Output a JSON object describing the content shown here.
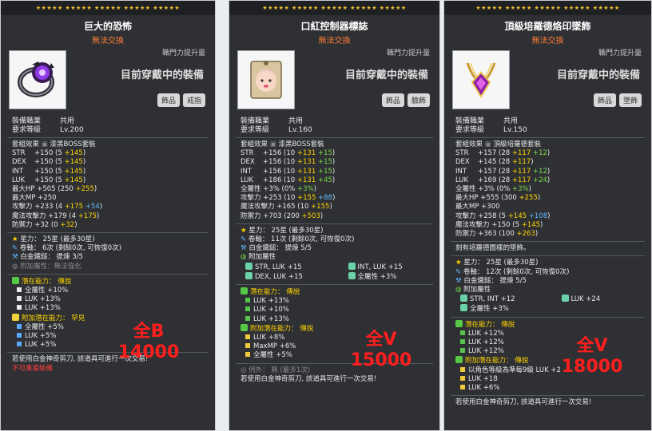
{
  "panels": [
    {
      "stars": "★★★★★   ★★★★★   ★★★★★   ★★★★★   ★★★★★",
      "title": "巨大的恐怖",
      "tradable": "無法交換",
      "equip_label": "職門力提升量",
      "equip_status": "目前穿戴中的裝備",
      "tags": [
        "飾品",
        "戒指"
      ],
      "job_label": "裝備職業",
      "job_value": "共用",
      "level_label": "要求等級",
      "level_value": "Lv.200",
      "set_label": "套組效果",
      "set_value": "漆黑BOSS套裝",
      "price_line1": "全B",
      "price_line2": "14000"
    },
    {
      "stars": "★★★★★   ★★★★★   ★★★★★   ★★★★★   ★★★★★",
      "title": "口紅控制器標誌",
      "tradable": "無法交換",
      "equip_label": "職門力提升量",
      "equip_status": "目前穿戴中的裝備",
      "tags": [
        "飾品",
        "臉飾"
      ],
      "job_label": "裝備職業",
      "job_value": "共用",
      "level_label": "要求等級",
      "level_value": "Lv.160",
      "set_label": "套組效果",
      "set_value": "漆黑BOSS套裝",
      "price_line1": "全V",
      "price_line2": "15000"
    },
    {
      "stars": "★★★★★   ★★★★★   ★★★★★   ★★★★★   ★★★★★",
      "title": "頂級培羅德烙印墜飾",
      "tradable": "無法交換",
      "equip_label": "職門力提升量",
      "equip_status": "目前穿戴中的裝備",
      "tags": [
        "飾品",
        "墜飾"
      ],
      "job_label": "裝備職業",
      "job_value": "共用",
      "level_label": "要求等級",
      "level_value": "Lv.150",
      "set_label": "套組效果",
      "set_value": "頂級培羅德套裝",
      "price_line1": "全V",
      "price_line2": "18000"
    }
  ],
  "p0": {
    "stats": [
      [
        "STR",
        "+150 (5 ",
        "+145",
        ")"
      ],
      [
        "DEX",
        "+150 (5 ",
        "+145",
        ")"
      ],
      [
        "INT",
        "+150 (5 ",
        "+145",
        ")"
      ],
      [
        "LUK",
        "+150 (5 ",
        "+145",
        ")"
      ]
    ],
    "hp": "最大HP  +505 (250 ",
    "hp_b": "+255",
    "mp": "最大MP  +250",
    "atk": "攻擊力  +233 (4 ",
    "atk_b": "+175",
    "atk_c": "+54",
    "matk": "魔法攻擊力  +179 (4 ",
    "matk_b": "+175",
    "def": "防禦力  +32 (0 ",
    "def_b": "+32",
    "star": "星力：  25星  (最多30星)",
    "scroll": "卷軸：  6次  (剩餘0次, 可恢復0次)",
    "hammer": "白金鐵鎚：  提煉  3/5",
    "addprop": "附加屬性：無法強化",
    "pot_title": "潛在能力：  傳說",
    "pot": [
      "全屬性  +10%",
      "LUK  +13%",
      "LUK  +13%"
    ],
    "bpot_title": "附加潛在能力：  罕見",
    "bpot": [
      "全屬性  +5%",
      "LUK  +5%",
      "LUK  +5%"
    ],
    "note": "若使用白金神奇剪刀, 該道具可進行一次交易!",
    "warn": "不可重複裝備"
  },
  "p1": {
    "stats": [
      [
        "STR",
        "+156 (10 ",
        "+131",
        " +15",
        ")"
      ],
      [
        "DEX",
        "+156 (10 ",
        "+131",
        " +15",
        ")"
      ],
      [
        "INT",
        "+156 (10 ",
        "+131",
        " +15",
        ")"
      ],
      [
        "LUK",
        "+186 (10 ",
        "+131",
        " +45",
        ")"
      ]
    ],
    "all": "全屬性  +3% (0% ",
    "all_b": "+3%",
    "atk": "攻擊力  +253 (10 ",
    "atk_b": "+155",
    "atk_c": "+88",
    "matk": "魔法攻擊力  +165 (10 ",
    "matk_b": "+155",
    "def": "防禦力  +703 (200 ",
    "def_b": "+503",
    "star": "星力：  25星  (最多30星)",
    "scroll": "卷軸：  11次  (剩餘0次, 可恢復0次)",
    "hammer": "白金鐵鎚：  提煉  5/5",
    "addprop": "附加屬性",
    "add": [
      "STR, LUK  +15",
      "INT, LUK  +15",
      "DEX, LUK  +15",
      "全屬性  +3%"
    ],
    "pot_title": "潛在能力：  傳說",
    "pot": [
      "LUK  +13%",
      "LUK  +10%",
      "LUK  +13%"
    ],
    "bpot_title": "附加潛在能力：  傳說",
    "bpot": [
      "LUK  +8%",
      "MaxMP  +6%",
      "全屬性  +5%"
    ],
    "exam": "例外：  無  (最多1次)",
    "note": "若使用白金神奇剪刀, 該道具可進行一次交易!"
  },
  "p2": {
    "stats": [
      [
        "STR",
        "+157 (28 ",
        "+117",
        " +12",
        ")"
      ],
      [
        "DEX",
        "+145 (28 ",
        "+117",
        "",
        ")"
      ],
      [
        "INT",
        "+157 (28 ",
        "+117",
        " +12",
        ")"
      ],
      [
        "LUK",
        "+169 (28 ",
        "+117",
        " +24",
        ")"
      ]
    ],
    "all": "全屬性  +3% (0% ",
    "all_b": "+3%",
    "hp": "最大HP  +555 (300 ",
    "hp_b": "+255",
    "mp": "最大MP  +300",
    "atk": "攻擊力  +258 (5 ",
    "atk_b": "+145",
    "atk_c": "+108",
    "matk": "魔法攻擊力  +150 (5 ",
    "matk_b": "+145",
    "def": "防禦力  +363 (100 ",
    "def_b": "+263",
    "desc": "刻有培羅德圖樣的墜飾。",
    "star": "星力：  25星  (最多30星)",
    "scroll": "卷軸：  12次  (剩餘0次, 可恢復0次)",
    "hammer": "白金鐵鎚：  提煉  5/5",
    "addprop": "附加屬性",
    "add": [
      "STR, INT  +12",
      "LUK  +24",
      "全屬性  +3%"
    ],
    "pot_title": "潛在能力：  傳說",
    "pot": [
      "LUK  +12%",
      "LUK  +12%",
      "LUK  +12%"
    ],
    "bpot_title": "附加潛在能力：  傳說",
    "bpot": [
      "以角色等級為準每9級 LUK +2",
      "LUK  +18",
      "LUK  +6%"
    ],
    "note": "若使用白金神奇剪刀, 該道具可進行一次交易!"
  }
}
